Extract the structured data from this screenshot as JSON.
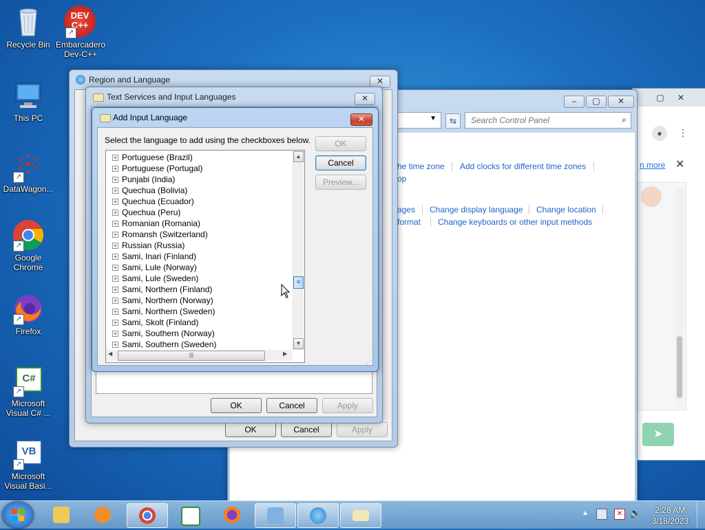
{
  "desktop": {
    "icons": [
      {
        "label": "Recycle Bin"
      },
      {
        "label": "Embarcadero Dev-C++"
      },
      {
        "label": "This PC"
      },
      {
        "label": "DataWagon..."
      },
      {
        "label": "Google Chrome"
      },
      {
        "label": "Firefox"
      },
      {
        "label": "Microsoft Visual C# ..."
      },
      {
        "label": "Microsoft Visual Basi..."
      }
    ],
    "devcpp_badge": "DEV C++"
  },
  "control_panel": {
    "search_placeholder": "Search Control Panel",
    "links": {
      "time_zone": "he time zone",
      "add_clocks": "Add clocks for different time zones",
      "op": "op",
      "ages": "ages",
      "change_display_language": "Change display language",
      "change_location": "Change location",
      "format": "format",
      "change_keyboards": "Change keyboards or other input methods"
    },
    "learn_more": "n more"
  },
  "region_dialog": {
    "title": "Region and Language",
    "ok": "OK",
    "cancel": "Cancel",
    "apply": "Apply"
  },
  "text_services_dialog": {
    "title": "Text Services and Input Languages",
    "ok": "OK",
    "cancel": "Cancel",
    "apply": "Apply"
  },
  "add_input_dialog": {
    "title": "Add Input Language",
    "instruction": "Select the language to add using the checkboxes below.",
    "ok": "OK",
    "cancel": "Cancel",
    "preview": "Preview...",
    "languages": [
      "Portuguese (Brazil)",
      "Portuguese (Portugal)",
      "Punjabi (India)",
      "Quechua (Bolivia)",
      "Quechua (Ecuador)",
      "Quechua (Peru)",
      "Romanian (Romania)",
      "Romansh (Switzerland)",
      "Russian (Russia)",
      "Sami, Inari (Finland)",
      "Sami, Lule (Norway)",
      "Sami, Lule (Sweden)",
      "Sami, Northern (Finland)",
      "Sami, Northern (Norway)",
      "Sami, Northern (Sweden)",
      "Sami, Skolt (Finland)",
      "Sami, Southern (Norway)",
      "Sami, Southern (Sweden)"
    ]
  },
  "taskbar": {
    "time": "2:28 AM",
    "date": "3/18/2023"
  }
}
